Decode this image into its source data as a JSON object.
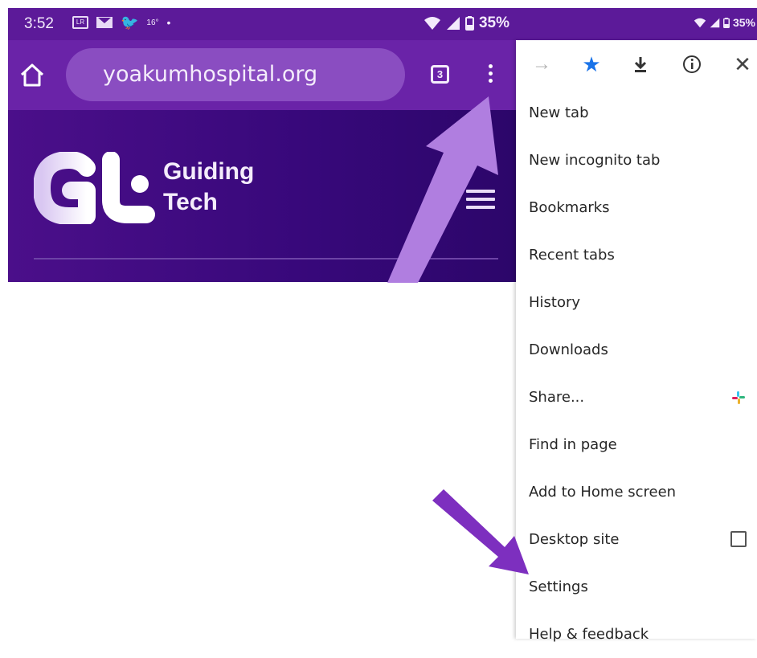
{
  "status_bar": {
    "time": "3:52",
    "temperature": "16°",
    "battery": "35%"
  },
  "browser": {
    "url": "yoakumhospital.org",
    "tab_count": "3"
  },
  "site": {
    "brand_line1": "Guiding",
    "brand_line2": "Tech"
  },
  "right_status": {
    "battery": "35%"
  },
  "menu_toolbar": {
    "icons": [
      "forward-icon",
      "star-icon",
      "download-icon",
      "info-icon",
      "close-icon"
    ]
  },
  "menu": {
    "items": [
      {
        "label": "New tab"
      },
      {
        "label": "New incognito tab"
      },
      {
        "label": "Bookmarks"
      },
      {
        "label": "Recent tabs"
      },
      {
        "label": "History"
      },
      {
        "label": "Downloads"
      },
      {
        "label": "Share..."
      },
      {
        "label": "Find in page"
      },
      {
        "label": "Add to Home screen"
      },
      {
        "label": "Desktop site",
        "checked": false
      },
      {
        "label": "Settings"
      },
      {
        "label": "Help & feedback"
      }
    ]
  },
  "colors": {
    "status_bar": "#5c1a99",
    "toolbar": "#6a23a8",
    "header": "#37087a",
    "arrow_light": "#b07ee0",
    "arrow_dark": "#7d2fbf",
    "star": "#1a73e8"
  }
}
